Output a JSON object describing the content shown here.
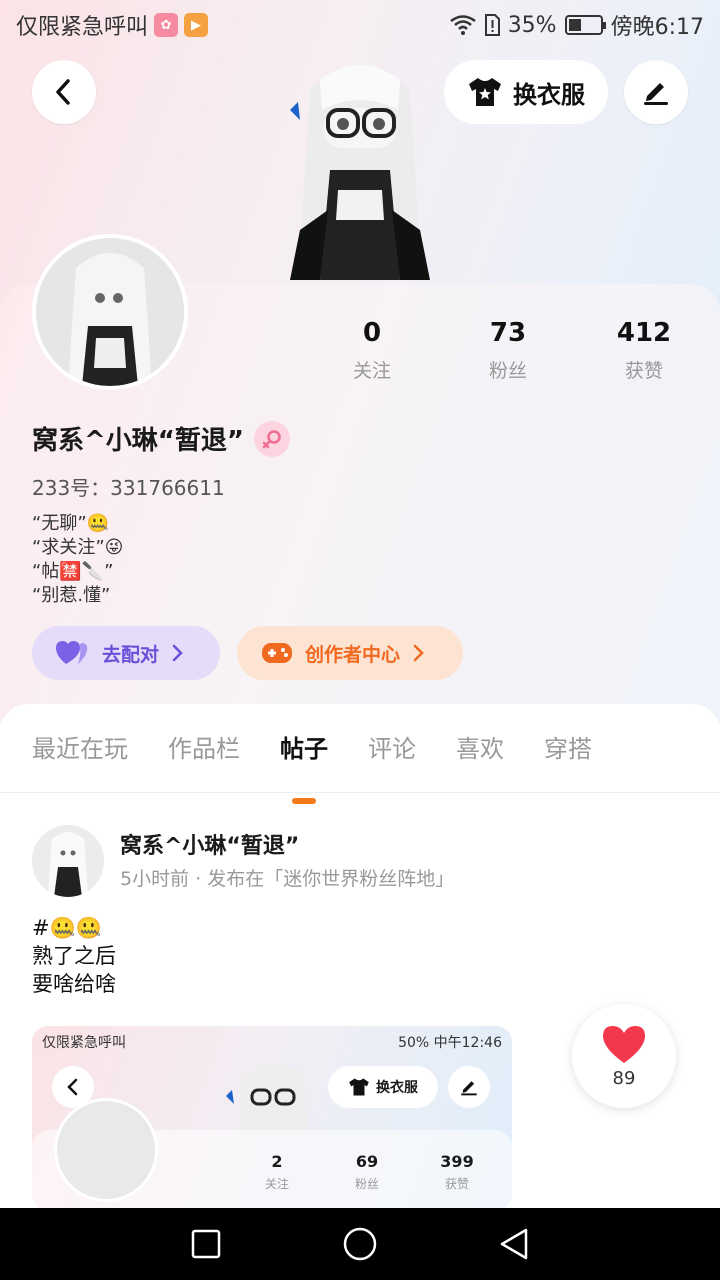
{
  "status_bar": {
    "left_text": "仅限紧急呼叫",
    "battery": "35%",
    "time": "傍晚6:17"
  },
  "top_bar": {
    "outfit_label": "换衣服"
  },
  "profile": {
    "username": "窝系^小琳“暂退”",
    "uid": "233号：331766611",
    "bio": [
      "“无聊”🤐",
      "“求关注”😜",
      "“帖🈲🔪”",
      "“别惹.懂”"
    ],
    "stats": [
      {
        "value": "0",
        "label": "关注"
      },
      {
        "value": "73",
        "label": "粉丝"
      },
      {
        "value": "412",
        "label": "获赞"
      }
    ],
    "match_label": "去配对",
    "creator_label": "创作者中心"
  },
  "tabs": [
    {
      "label": "最近在玩",
      "active": false
    },
    {
      "label": "作品栏",
      "active": false
    },
    {
      "label": "帖子",
      "active": true
    },
    {
      "label": "评论",
      "active": false
    },
    {
      "label": "喜欢",
      "active": false
    },
    {
      "label": "穿搭",
      "active": false
    }
  ],
  "post": {
    "author": "窝系^小琳“暂退”",
    "meta": "5小时前 · 发布在「迷你世界粉丝阵地」",
    "body": [
      "#🤐🤐",
      "熟了之后",
      "要啥给啥"
    ],
    "likes": "89",
    "screenshot": {
      "status_left": "仅限紧急呼叫",
      "status_right": "50%   中午12:46",
      "outfit_label": "换衣服",
      "stats": [
        {
          "value": "2",
          "label": "关注"
        },
        {
          "value": "69",
          "label": "粉丝"
        },
        {
          "value": "399",
          "label": "获赞"
        }
      ]
    }
  },
  "colors": {
    "accent_orange": "#f07a1a",
    "match_purple": "#6a4fd8",
    "like_red": "#f2384a"
  }
}
